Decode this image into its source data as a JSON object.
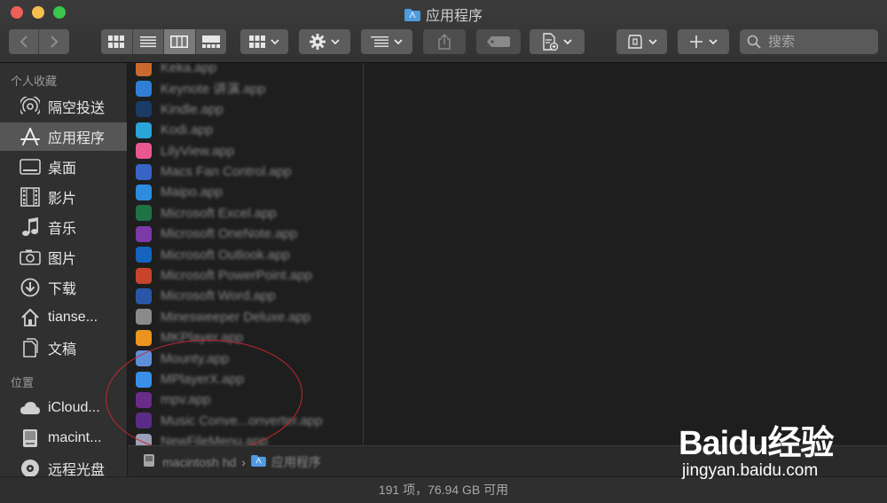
{
  "window": {
    "title": "应用程序"
  },
  "toolbar": {
    "search_placeholder": "搜索"
  },
  "sidebar": {
    "sections": [
      {
        "title": "个人收藏"
      },
      {
        "title": "位置"
      }
    ],
    "favorites": [
      {
        "label": "隔空投送",
        "icon": "airdrop-icon"
      },
      {
        "label": "应用程序",
        "icon": "applications-icon",
        "active": true
      },
      {
        "label": "桌面",
        "icon": "desktop-icon"
      },
      {
        "label": "影片",
        "icon": "movies-icon"
      },
      {
        "label": "音乐",
        "icon": "music-icon"
      },
      {
        "label": "图片",
        "icon": "pictures-icon"
      },
      {
        "label": "下载",
        "icon": "downloads-icon"
      },
      {
        "label": "tianse...",
        "icon": "home-icon"
      },
      {
        "label": "文稿",
        "icon": "documents-icon"
      }
    ],
    "locations": [
      {
        "label": "iCloud...",
        "icon": "icloud-icon"
      },
      {
        "label": "macint...",
        "icon": "disk-icon"
      },
      {
        "label": "远程光盘",
        "icon": "remote-disc-icon"
      }
    ]
  },
  "files": [
    {
      "name": "Keka.app",
      "color": "#c8692f"
    },
    {
      "name": "Keynote 讲演.app",
      "color": "#2f7fd6"
    },
    {
      "name": "Kindle.app",
      "color": "#1a3b66"
    },
    {
      "name": "Kodi.app",
      "color": "#2aa4d9"
    },
    {
      "name": "LilyView.app",
      "color": "#e8588e"
    },
    {
      "name": "Macs Fan Control.app",
      "color": "#3a63c6"
    },
    {
      "name": "Maipo.app",
      "color": "#2c8de0"
    },
    {
      "name": "Microsoft Excel.app",
      "color": "#1f7244"
    },
    {
      "name": "Microsoft OneNote.app",
      "color": "#7b3aa8"
    },
    {
      "name": "Microsoft Outlook.app",
      "color": "#1564c0"
    },
    {
      "name": "Microsoft PowerPoint.app",
      "color": "#c8442a"
    },
    {
      "name": "Microsoft Word.app",
      "color": "#2a56a8"
    },
    {
      "name": "Minesweeper Deluxe.app",
      "color": "#8a8a8a"
    },
    {
      "name": "MKPlayer.app",
      "color": "#e9951f"
    },
    {
      "name": "Mounty.app",
      "color": "#5f8fd8"
    },
    {
      "name": "MPlayerX.app",
      "color": "#3a8ee8"
    },
    {
      "name": "mpv.app",
      "color": "#6a2b8a"
    },
    {
      "name": "Music Conve...onverter.app",
      "color": "#5b2c86"
    },
    {
      "name": "NewFileMenu.app",
      "color": "#9aa0b8"
    }
  ],
  "pathbar": {
    "disk": "macintosh hd",
    "folder": "应用程序"
  },
  "status": {
    "text": "191 项，76.94 GB 可用"
  },
  "watermark": {
    "main": "Baidu经验",
    "sub": "jingyan.baidu.com"
  },
  "colors": {
    "accent_circle": "#c0282d"
  }
}
